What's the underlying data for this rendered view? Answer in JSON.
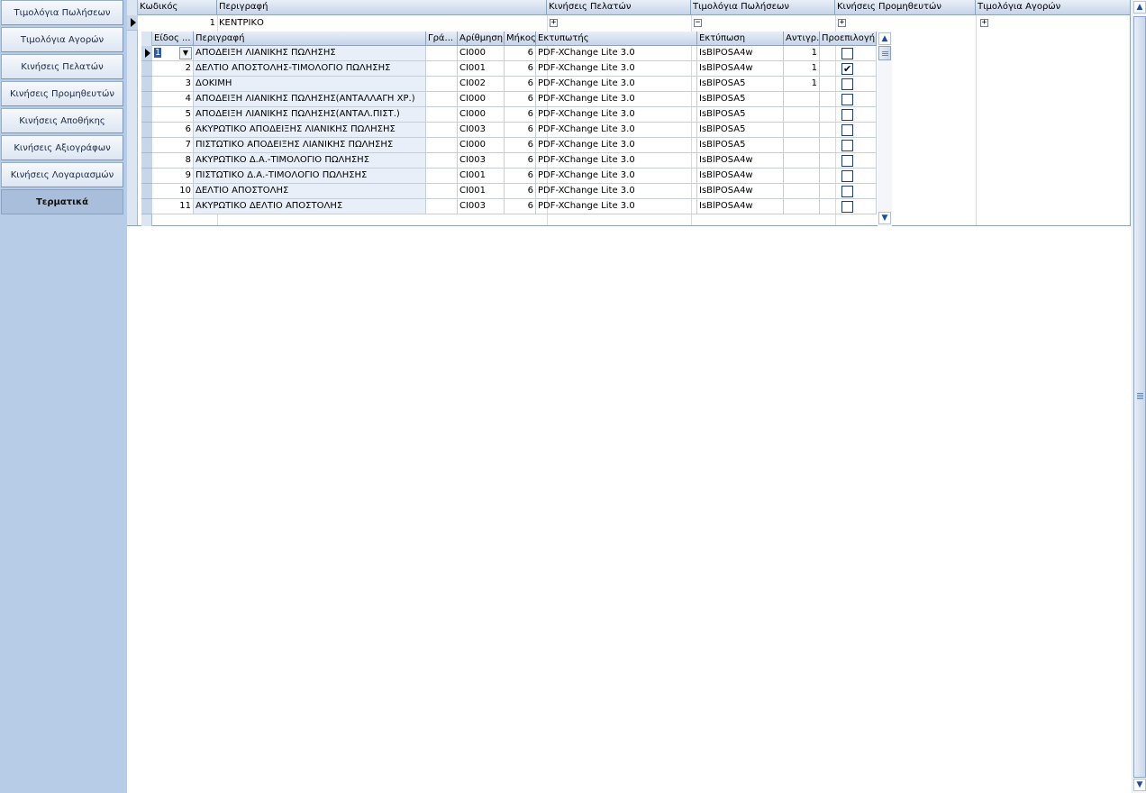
{
  "nav": {
    "items": [
      {
        "label": "Τιμολόγια Πωλήσεων"
      },
      {
        "label": "Τιμολόγια Αγορών"
      },
      {
        "label": "Κινήσεις Πελατών"
      },
      {
        "label": "Κινήσεις Προμηθευτών"
      },
      {
        "label": "Κινήσεις Αποθήκης"
      },
      {
        "label": "Κινήσεις Αξιογράφων"
      },
      {
        "label": "Κινήσεις Λογαριασμών"
      },
      {
        "label": "Τερματικά",
        "active": true
      }
    ]
  },
  "master": {
    "columns": [
      "Κωδικός",
      "Περιγραφή",
      "Κινήσεις Πελατών",
      "Τιμολόγια Πωλήσεων",
      "Κινήσεις Προμηθευτών",
      "Τιμολόγια Αγορών"
    ],
    "row": {
      "code": "1",
      "description": "ΚΕΝΤΡΙΚΟ",
      "expanders": [
        "+",
        "−",
        "+",
        "+"
      ]
    }
  },
  "detail": {
    "columns": [
      "Είδος ...",
      "Περιγραφή",
      "Γρά...",
      "Αρίθμηση",
      "Μήκος",
      "Εκτυπωτής",
      "Εκτύπωση",
      "Αντιγρ.",
      "Προεπιλογή"
    ],
    "rows": [
      {
        "type": "1",
        "description": "ΑΠΟΔΕΙΞΗ ΛΙΑΝΙΚΗΣ ΠΩΛΗΣΗΣ",
        "series": "",
        "numbering": "CI000",
        "length": "6",
        "printer": "PDF-XChange Lite 3.0",
        "print": "IsBlPOSA4w",
        "copies": "1",
        "default": false
      },
      {
        "type": "2",
        "description": "ΔΕΛΤΙΟ ΑΠΟΣΤΟΛΗΣ-ΤΙΜΟΛΟΓΙΟ ΠΩΛΗΣΗΣ",
        "series": "",
        "numbering": "CI001",
        "length": "6",
        "printer": "PDF-XChange Lite 3.0",
        "print": "IsBlPOSA4w",
        "copies": "1",
        "default": true
      },
      {
        "type": "3",
        "description": "ΔΟΚΙΜΗ",
        "series": "",
        "numbering": "CI002",
        "length": "6",
        "printer": "PDF-XChange Lite 3.0",
        "print": "IsBlPOSA5",
        "copies": "1",
        "default": false
      },
      {
        "type": "4",
        "description": "ΑΠΟΔΕΙΞΗ ΛΙΑΝΙΚΗΣ ΠΩΛΗΣΗΣ(ΑΝΤΑΛΛΑΓΗ ΧΡ.)",
        "series": "",
        "numbering": "CI000",
        "length": "6",
        "printer": "PDF-XChange Lite 3.0",
        "print": "IsBlPOSA5",
        "copies": "",
        "default": false
      },
      {
        "type": "5",
        "description": "ΑΠΟΔΕΙΞΗ ΛΙΑΝΙΚΗΣ ΠΩΛΗΣΗΣ(ΑΝΤΑΛ.ΠΙΣΤ.)",
        "series": "",
        "numbering": "CI000",
        "length": "6",
        "printer": "PDF-XChange Lite 3.0",
        "print": "IsBlPOSA5",
        "copies": "",
        "default": false
      },
      {
        "type": "6",
        "description": "ΑΚΥΡΩΤΙΚΟ ΑΠΟΔΕΙΞΗΣ ΛΙΑΝΙΚΗΣ ΠΩΛΗΣΗΣ",
        "series": "",
        "numbering": "CI003",
        "length": "6",
        "printer": "PDF-XChange Lite 3.0",
        "print": "IsBlPOSA5",
        "copies": "",
        "default": false
      },
      {
        "type": "7",
        "description": "ΠΙΣΤΩΤΙΚΟ ΑΠΟΔΕΙΞΗΣ ΛΙΑΝΙΚΗΣ ΠΩΛΗΣΗΣ",
        "series": "",
        "numbering": "CI000",
        "length": "6",
        "printer": "PDF-XChange Lite 3.0",
        "print": "IsBlPOSA5",
        "copies": "",
        "default": false
      },
      {
        "type": "8",
        "description": "ΑΚΥΡΩΤΙΚΟ Δ.Α.-ΤΙΜΟΛΟΓΙΟ ΠΩΛΗΣΗΣ",
        "series": "",
        "numbering": "CI003",
        "length": "6",
        "printer": "PDF-XChange Lite 3.0",
        "print": "IsBlPOSA4w",
        "copies": "",
        "default": false
      },
      {
        "type": "9",
        "description": "ΠΙΣΤΩΤΙΚΟ Δ.Α.-ΤΙΜΟΛΟΓΙΟ ΠΩΛΗΣΗΣ",
        "series": "",
        "numbering": "CI001",
        "length": "6",
        "printer": "PDF-XChange Lite 3.0",
        "print": "IsBlPOSA4w",
        "copies": "",
        "default": false
      },
      {
        "type": "10",
        "description": "ΔΕΛΤΙΟ ΑΠΟΣΤΟΛΗΣ",
        "series": "",
        "numbering": "CI001",
        "length": "6",
        "printer": "PDF-XChange Lite 3.0",
        "print": "IsBlPOSA4w",
        "copies": "",
        "default": false
      },
      {
        "type": "11",
        "description": "ΑΚΥΡΩΤΙΚΟ ΔΕΛΤΙΟ ΑΠΟΣΤΟΛΗΣ",
        "series": "",
        "numbering": "CI003",
        "length": "6",
        "printer": "PDF-XChange Lite 3.0",
        "print": "IsBlPOSA4w",
        "copies": "",
        "default": false
      }
    ]
  },
  "icons": {
    "row_indicator": "triangle-right-icon",
    "combo_arrow": "chevron-down-icon",
    "scroll_up": "chevron-up-icon",
    "scroll_down": "chevron-down-icon"
  },
  "colors": {
    "nav_background": "#b7cce6",
    "header_gradient_top": "#e9eff8",
    "header_gradient_bottom": "#c6d4e8",
    "shaded_column": "#e8eff8",
    "selection": "#2b5ba5"
  }
}
